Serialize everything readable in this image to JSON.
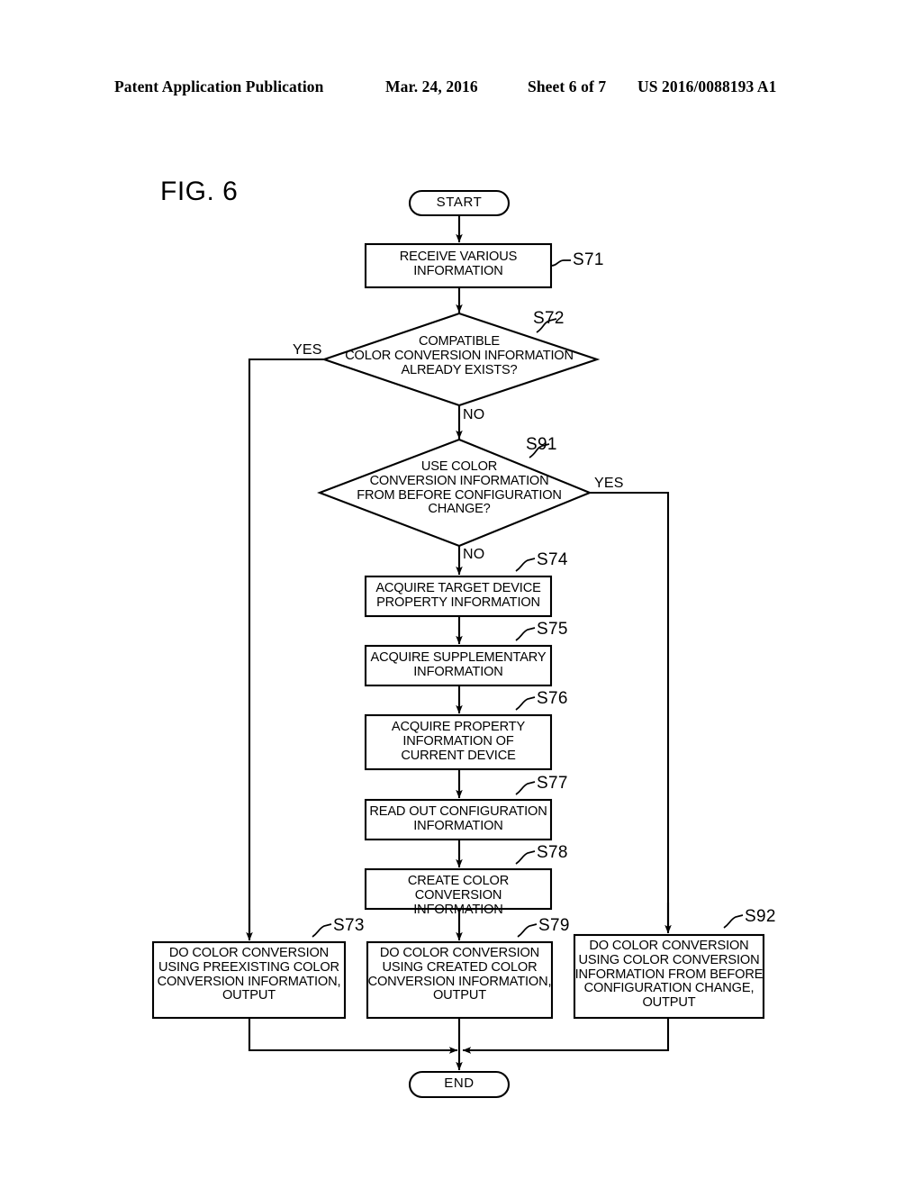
{
  "header": {
    "publication": "Patent Application Publication",
    "date": "Mar. 24, 2016",
    "sheet": "Sheet 6 of 7",
    "patent_number": "US 2016/0088193 A1"
  },
  "figure": {
    "label": "FIG. 6",
    "type": "flowchart"
  },
  "flowchart": {
    "nodes": {
      "start": {
        "id": "START",
        "shape": "terminator",
        "text": "START"
      },
      "s71": {
        "id": "S71",
        "shape": "process",
        "text": "RECEIVE VARIOUS\nINFORMATION",
        "step": "S71"
      },
      "s72": {
        "id": "S72",
        "shape": "decision",
        "text": "COMPATIBLE\nCOLOR CONVERSION INFORMATION\nALREADY EXISTS?",
        "step": "S72",
        "yes_label": "YES",
        "no_label": "NO"
      },
      "s91": {
        "id": "S91",
        "shape": "decision",
        "text": "USE COLOR\nCONVERSION INFORMATION\nFROM BEFORE CONFIGURATION\nCHANGE?",
        "step": "S91",
        "yes_label": "YES",
        "no_label": "NO"
      },
      "s74": {
        "id": "S74",
        "shape": "process",
        "text": "ACQUIRE TARGET DEVICE\nPROPERTY INFORMATION",
        "step": "S74"
      },
      "s75": {
        "id": "S75",
        "shape": "process",
        "text": "ACQUIRE SUPPLEMENTARY\nINFORMATION",
        "step": "S75"
      },
      "s76": {
        "id": "S76",
        "shape": "process",
        "text": "ACQUIRE PROPERTY\nINFORMATION OF\nCURRENT DEVICE",
        "step": "S76"
      },
      "s77": {
        "id": "S77",
        "shape": "process",
        "text": "READ OUT CONFIGURATION\nINFORMATION",
        "step": "S77"
      },
      "s78": {
        "id": "S78",
        "shape": "process",
        "text": "CREATE COLOR CONVERSION\nINFORMATION",
        "step": "S78"
      },
      "s73": {
        "id": "S73",
        "shape": "process",
        "text": "DO COLOR CONVERSION\nUSING PREEXISTING COLOR\nCONVERSION INFORMATION,\nOUTPUT",
        "step": "S73"
      },
      "s79": {
        "id": "S79",
        "shape": "process",
        "text": "DO COLOR CONVERSION\nUSING CREATED COLOR\nCONVERSION INFORMATION,\nOUTPUT",
        "step": "S79"
      },
      "s92": {
        "id": "S92",
        "shape": "process",
        "text": "DO COLOR CONVERSION\nUSING COLOR CONVERSION\nINFORMATION FROM BEFORE\nCONFIGURATION CHANGE,\nOUTPUT",
        "step": "S92"
      },
      "end": {
        "id": "END",
        "shape": "terminator",
        "text": "END"
      }
    },
    "edges": [
      {
        "from": "START",
        "to": "S71",
        "label": ""
      },
      {
        "from": "S71",
        "to": "S72",
        "label": ""
      },
      {
        "from": "S72",
        "to": "S73",
        "label": "YES"
      },
      {
        "from": "S72",
        "to": "S91",
        "label": "NO"
      },
      {
        "from": "S91",
        "to": "S92",
        "label": "YES"
      },
      {
        "from": "S91",
        "to": "S74",
        "label": "NO"
      },
      {
        "from": "S74",
        "to": "S75",
        "label": ""
      },
      {
        "from": "S75",
        "to": "S76",
        "label": ""
      },
      {
        "from": "S76",
        "to": "S77",
        "label": ""
      },
      {
        "from": "S77",
        "to": "S78",
        "label": ""
      },
      {
        "from": "S78",
        "to": "S79",
        "label": ""
      },
      {
        "from": "S73",
        "to": "END",
        "label": ""
      },
      {
        "from": "S79",
        "to": "END",
        "label": ""
      },
      {
        "from": "S92",
        "to": "END",
        "label": ""
      }
    ]
  },
  "colors": {
    "ink": "#000000",
    "paper": "#ffffff"
  }
}
